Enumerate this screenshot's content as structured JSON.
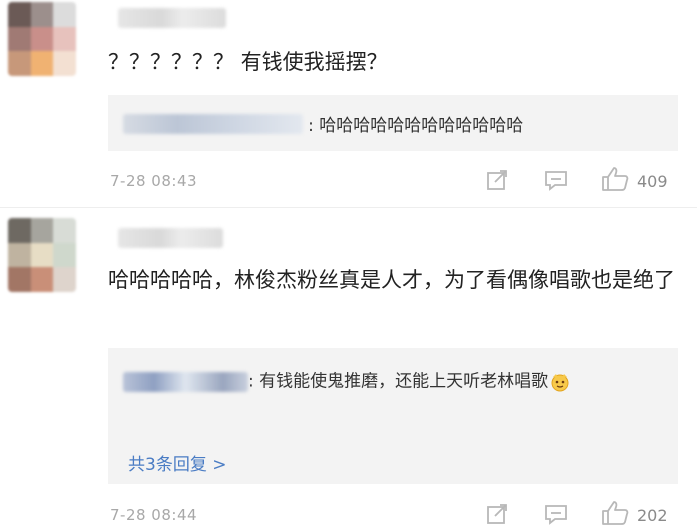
{
  "comments": [
    {
      "text": "？？？？？？ 有钱使我摇摆？",
      "reply": {
        "text": ": 哈哈哈哈哈哈哈哈哈哈哈哈"
      },
      "time": "7-28 08:43",
      "likes": "409",
      "avatar_colors": [
        "#6b5a56",
        "#9c8f8c",
        "#dcdcdc",
        "#a07a74",
        "#c98f8a",
        "#e7c2bd",
        "#c7987a",
        "#f0b272",
        "#f3e0d2"
      ]
    },
    {
      "text": "哈哈哈哈哈，林俊杰粉丝真是人才，为了看偶像唱歌也是绝了",
      "reply": {
        "text": ": 有钱能使鬼推磨，还能上天听老林唱歌"
      },
      "more_replies": "共3条回复 >",
      "time": "7-28 08:44",
      "likes": "202",
      "avatar_colors": [
        "#6e6962",
        "#a6a59e",
        "#d8dcd6",
        "#bfb3a0",
        "#e7ddc5",
        "#cfd8cc",
        "#a27665",
        "#c98f78",
        "#ded4cc"
      ]
    }
  ],
  "icons": {
    "share": "share-icon",
    "comment": "comment-icon",
    "like": "thumbs-up-icon",
    "emoji": "emoji-icon"
  }
}
